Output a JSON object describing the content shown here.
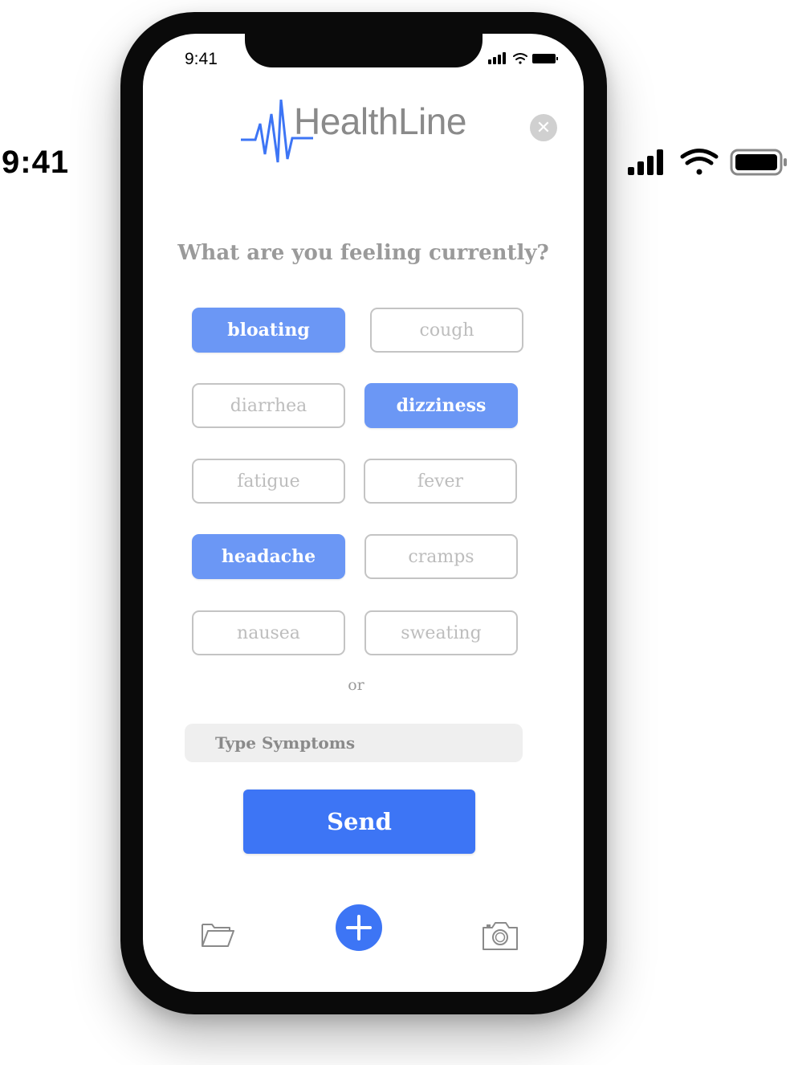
{
  "status_bar": {
    "time": "9:41"
  },
  "phone_status_bar": {
    "time": "9:41"
  },
  "header": {
    "logo_text": "HealthLine",
    "close_icon": "close-icon",
    "close_symbol": "✕"
  },
  "prompt": {
    "question": "What are you feeling currently?"
  },
  "symptoms": [
    {
      "label": "bloating",
      "selected": true
    },
    {
      "label": "cough",
      "selected": false
    },
    {
      "label": "diarrhea",
      "selected": false
    },
    {
      "label": "dizziness",
      "selected": true
    },
    {
      "label": "fatigue",
      "selected": false
    },
    {
      "label": "fever",
      "selected": false
    },
    {
      "label": "headache",
      "selected": true
    },
    {
      "label": "cramps",
      "selected": false
    },
    {
      "label": "nausea",
      "selected": false
    },
    {
      "label": "sweating",
      "selected": false
    }
  ],
  "divider": {
    "or_label": "or"
  },
  "input": {
    "value": "",
    "placeholder": "Type Symptoms"
  },
  "actions": {
    "send_label": "Send"
  },
  "bottom_bar": {
    "left_icon": "folder-icon",
    "center_icon": "plus-icon",
    "right_icon": "camera-icon"
  },
  "colors": {
    "accent": "#3d75f5",
    "chip_selected": "#6b97f5",
    "chip_border": "#c4c4c4",
    "text_muted": "#9a9a9a",
    "logo_wave": "#3d75f5"
  }
}
